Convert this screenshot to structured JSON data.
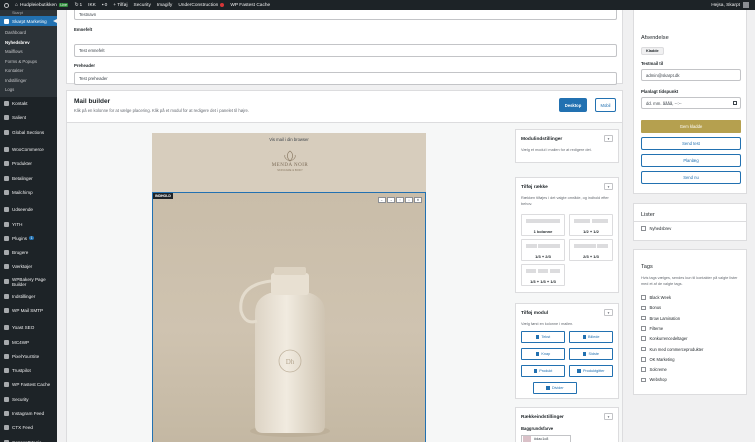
{
  "adminbar": {
    "site_name": "Hudpleiebutikken",
    "site_badge": "Live",
    "updates_count": "1",
    "seo_label": "IKK",
    "comments_count": "0",
    "new_label": "+ Tilføj",
    "security_label": "Security",
    "imagify_label": "Imagify",
    "uc_label": "UnderConstruction",
    "cache_label": "WP Fastest Cache",
    "greeting": "Hejsa, Skarpt"
  },
  "sidebar": {
    "top_item": "Skarpt",
    "current": "Skarpt Marketing",
    "submenu": [
      "Dashboard",
      "Nyhedsbrev",
      "Mailflows",
      "Forms & Popups",
      "Kontakter",
      "Indstillinger",
      "Logs"
    ],
    "active_sub": "Nyhedsbrev",
    "menu": [
      {
        "label": "Kontakt"
      },
      {
        "label": "Salient"
      },
      {
        "label": "Global Sections"
      },
      {
        "label": "WooCommerce"
      },
      {
        "label": "Produkter"
      },
      {
        "label": "Betalinger"
      },
      {
        "label": "Mailchimp"
      },
      {
        "label": "Udseende"
      },
      {
        "label": "YITH"
      },
      {
        "label": "Plugins",
        "count": "1"
      },
      {
        "label": "Brugere"
      },
      {
        "label": "Værktøjer"
      },
      {
        "label": "WPBakery Page Builder"
      },
      {
        "label": "Indstillinger"
      },
      {
        "label": "WP Mail SMTP"
      },
      {
        "label": "Yoast SEO"
      },
      {
        "label": "MC4WP"
      },
      {
        "label": "PixelYourSite"
      },
      {
        "label": "Trustpilot"
      },
      {
        "label": "WP Fastest Cache"
      },
      {
        "label": "Security"
      },
      {
        "label": "Instagram Feed"
      },
      {
        "label": "CTX Feed"
      },
      {
        "label": "ConsentMagic"
      },
      {
        "label": "Minimer menu"
      }
    ]
  },
  "form": {
    "name_value": "Testnavn",
    "subject_label": "Emnefelt",
    "subject_value": "Test emnefelt",
    "preheader_label": "Preheader",
    "preheader_value": "Test preheader"
  },
  "mailbuilder": {
    "title": "Mail builder",
    "description": "Klik på en kolonne for at vælge placering. Klik på et modul for at redigere det i panelet til højre.",
    "desktop_label": "Desktop",
    "mobile_label": "Mobil"
  },
  "email_preview": {
    "browser_link": "Vis mail i din browser",
    "brand_name": "MENDA NOIR",
    "brand_sub": "SKINCARE & BODY",
    "section_badge": "INDHOLD",
    "controls": [
      "←",
      "→",
      "↑",
      "↓",
      "✕"
    ]
  },
  "panels": {
    "module_settings": {
      "title": "Modulindstillinger",
      "desc": "Vælg et modul i mailen for at redigere det."
    },
    "add_row": {
      "title": "Tilføj række",
      "desc": "Rækken tilføjes i det valgte område, og indhold efter behov.",
      "layouts": [
        "1 kolonne",
        "1/2 + 1/2",
        "1/3 + 2/3",
        "2/3 + 1/3",
        "1/3 + 1/3 + 1/3"
      ]
    },
    "add_module": {
      "title": "Tilføj modul",
      "desc": "Vælg først en kolonne i mailen.",
      "modules": [
        "Tekst",
        "Billede",
        "Knap",
        "Sidste",
        "Produkt",
        "Produktgitter",
        "Divider"
      ]
    },
    "row_settings": {
      "title": "Rækkeindstillinger",
      "bg_label": "Baggrundsfarve",
      "bg_value": "#dac1c8"
    }
  },
  "sender": {
    "title": "Afsendelse",
    "status": "Kladde",
    "testmail_label": "Testmail til",
    "testmail_value": "admin@skarpt.dk",
    "schedule_label": "Planlagt tidspunkt",
    "schedule_placeholder": "dd. mm. åååå, --:--",
    "save_draft": "Gem kladde",
    "send_test": "Send test",
    "schedule_btn": "Planlæg",
    "send_now": "Send nu"
  },
  "lists": {
    "title": "Lister",
    "items": [
      "Nyhedsbrev"
    ]
  },
  "tags": {
    "title": "Tags",
    "desc": "Hvis tags vælges, sendes kun til kontakter på valgte lister med et af de valgte tags.",
    "items": [
      "Black Week",
      "Bonus",
      "Brow Lamination",
      "Filterne",
      "Konkurrencedeltager",
      "Kun med commerceprodukter",
      "OK Marketing",
      "Solcreme",
      "Webshop"
    ]
  },
  "colors": {
    "accent": "#2271b1",
    "gold": "#b5a04f",
    "sidebar": "#1d2327",
    "email_bg": "#d7cdbd"
  }
}
